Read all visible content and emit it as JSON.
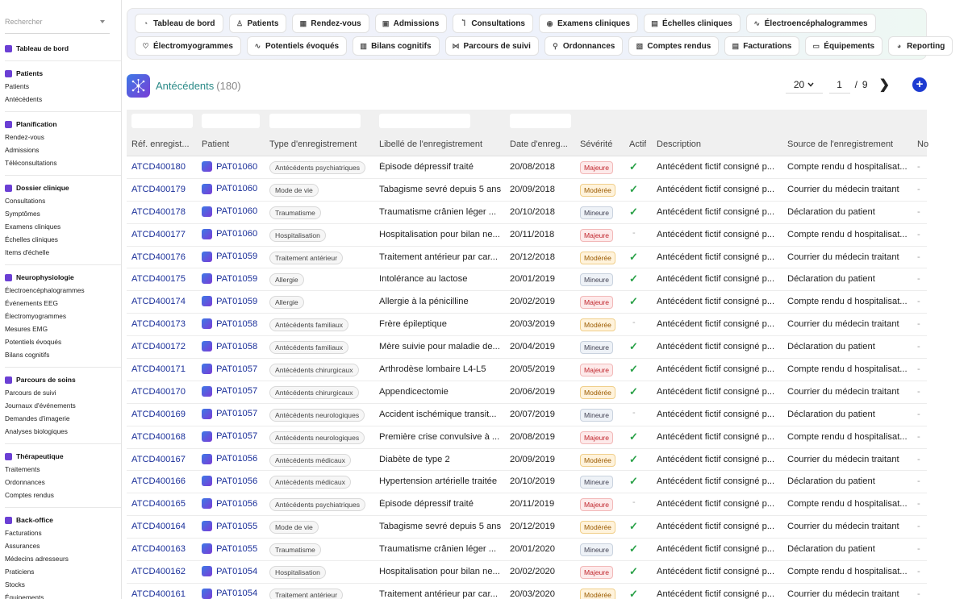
{
  "sidebar": {
    "search_placeholder": "Rechercher",
    "sections": [
      {
        "title": "Tableau de bord",
        "icon": "dashboard-icon",
        "items": []
      },
      {
        "title": "Patients",
        "icon": "user-icon",
        "items": [
          "Patients",
          "Antécédents"
        ]
      },
      {
        "title": "Planification",
        "icon": "calendar-icon",
        "items": [
          "Rendez-vous",
          "Admissions",
          "Téléconsultations"
        ]
      },
      {
        "title": "Dossier clinique",
        "icon": "stethoscope-icon",
        "items": [
          "Consultations",
          "Symptômes",
          "Examens cliniques",
          "Échelles cliniques",
          "Items d'échelle"
        ]
      },
      {
        "title": "Neurophysiologie",
        "icon": "waveform-icon",
        "items": [
          "Électroencéphalogrammes",
          "Événements EEG",
          "Électromyogrammes",
          "Mesures EMG",
          "Potentiels évoqués",
          "Bilans cognitifs"
        ]
      },
      {
        "title": "Parcours de soins",
        "icon": "flow-icon",
        "items": [
          "Parcours de suivi",
          "Journaux d'événements",
          "Demandes d'imagerie",
          "Analyses biologiques"
        ]
      },
      {
        "title": "Thérapeutique",
        "icon": "pills-icon",
        "items": [
          "Traitements",
          "Ordonnances",
          "Comptes rendus"
        ]
      },
      {
        "title": "Back-office",
        "icon": "building-icon",
        "items": [
          "Facturations",
          "Assurances",
          "Médecins adresseurs",
          "Praticiens",
          "Stocks",
          "Équipements"
        ]
      }
    ]
  },
  "nav": {
    "row1": [
      {
        "label": "Tableau de bord",
        "icon": "dashboard-icon"
      },
      {
        "label": "Patients",
        "icon": "user-icon"
      },
      {
        "label": "Rendez-vous",
        "icon": "calendar-icon"
      },
      {
        "label": "Admissions",
        "icon": "clipboard-icon"
      },
      {
        "label": "Consultations",
        "icon": "stethoscope-icon"
      },
      {
        "label": "Examens cliniques",
        "icon": "brain-icon"
      },
      {
        "label": "Échelles cliniques",
        "icon": "scale-icon"
      },
      {
        "label": "Électroencéphalogrammes",
        "icon": "waveform-icon"
      }
    ],
    "row2": [
      {
        "label": "Électromyogrammes",
        "icon": "heart-icon"
      },
      {
        "label": "Potentiels évoqués",
        "icon": "waveform-icon"
      },
      {
        "label": "Bilans cognitifs",
        "icon": "book-icon"
      },
      {
        "label": "Parcours de suivi",
        "icon": "flow-icon"
      },
      {
        "label": "Ordonnances",
        "icon": "pills-icon"
      },
      {
        "label": "Comptes rendus",
        "icon": "document-icon"
      },
      {
        "label": "Facturations",
        "icon": "invoice-icon"
      },
      {
        "label": "Équipements",
        "icon": "monitor-icon"
      },
      {
        "label": "Reporting",
        "icon": "pie-chart-icon"
      }
    ]
  },
  "page": {
    "title": "Antécédents",
    "count": "(180)",
    "per_page": "20",
    "current_page": "1",
    "separator": "/",
    "total_pages": "9",
    "next_label": "❯",
    "add_label": "+"
  },
  "table": {
    "columns": [
      "Réf. enregist...",
      "Patient",
      "Type d'enregistrement",
      "Libellé de l'enregistrement",
      "Date d'enreg...",
      "Sévérité",
      "Actif",
      "Description",
      "Source de l'enregistrement",
      "No"
    ],
    "rows": [
      {
        "ref": "ATCD400180",
        "patient": "PAT01060",
        "type": "Antécédents psychiatriques",
        "label": "Épisode dépressif traité",
        "date": "20/08/2018",
        "severity": "Majeure",
        "active": true,
        "description": "Antécédent fictif consigné p...",
        "source": "Compte rendu d hospitalisat...",
        "notes": "-"
      },
      {
        "ref": "ATCD400179",
        "patient": "PAT01060",
        "type": "Mode de vie",
        "label": "Tabagisme sevré depuis 5 ans",
        "date": "20/09/2018",
        "severity": "Modérée",
        "active": true,
        "description": "Antécédent fictif consigné p...",
        "source": "Courrier du médecin traitant",
        "notes": "-"
      },
      {
        "ref": "ATCD400178",
        "patient": "PAT01060",
        "type": "Traumatisme",
        "label": "Traumatisme crânien léger ...",
        "date": "20/10/2018",
        "severity": "Mineure",
        "active": true,
        "description": "Antécédent fictif consigné p...",
        "source": "Déclaration du patient",
        "notes": "-"
      },
      {
        "ref": "ATCD400177",
        "patient": "PAT01060",
        "type": "Hospitalisation",
        "label": "Hospitalisation pour bilan ne...",
        "date": "20/11/2018",
        "severity": "Majeure",
        "active": false,
        "description": "Antécédent fictif consigné p...",
        "source": "Compte rendu d hospitalisat...",
        "notes": "-"
      },
      {
        "ref": "ATCD400176",
        "patient": "PAT01059",
        "type": "Traitement antérieur",
        "label": "Traitement antérieur par car...",
        "date": "20/12/2018",
        "severity": "Modérée",
        "active": true,
        "description": "Antécédent fictif consigné p...",
        "source": "Courrier du médecin traitant",
        "notes": "-"
      },
      {
        "ref": "ATCD400175",
        "patient": "PAT01059",
        "type": "Allergie",
        "label": "Intolérance au lactose",
        "date": "20/01/2019",
        "severity": "Mineure",
        "active": true,
        "description": "Antécédent fictif consigné p...",
        "source": "Déclaration du patient",
        "notes": "-"
      },
      {
        "ref": "ATCD400174",
        "patient": "PAT01059",
        "type": "Allergie",
        "label": "Allergie à la pénicilline",
        "date": "20/02/2019",
        "severity": "Majeure",
        "active": true,
        "description": "Antécédent fictif consigné p...",
        "source": "Compte rendu d hospitalisat...",
        "notes": "-"
      },
      {
        "ref": "ATCD400173",
        "patient": "PAT01058",
        "type": "Antécédents familiaux",
        "label": "Frère épileptique",
        "date": "20/03/2019",
        "severity": "Modérée",
        "active": false,
        "description": "Antécédent fictif consigné p...",
        "source": "Courrier du médecin traitant",
        "notes": "-"
      },
      {
        "ref": "ATCD400172",
        "patient": "PAT01058",
        "type": "Antécédents familiaux",
        "label": "Mère suivie pour maladie de...",
        "date": "20/04/2019",
        "severity": "Mineure",
        "active": true,
        "description": "Antécédent fictif consigné p...",
        "source": "Déclaration du patient",
        "notes": "-"
      },
      {
        "ref": "ATCD400171",
        "patient": "PAT01057",
        "type": "Antécédents chirurgicaux",
        "label": "Arthrodèse lombaire L4-L5",
        "date": "20/05/2019",
        "severity": "Majeure",
        "active": true,
        "description": "Antécédent fictif consigné p...",
        "source": "Compte rendu d hospitalisat...",
        "notes": "-"
      },
      {
        "ref": "ATCD400170",
        "patient": "PAT01057",
        "type": "Antécédents chirurgicaux",
        "label": "Appendicectomie",
        "date": "20/06/2019",
        "severity": "Modérée",
        "active": true,
        "description": "Antécédent fictif consigné p...",
        "source": "Courrier du médecin traitant",
        "notes": "-"
      },
      {
        "ref": "ATCD400169",
        "patient": "PAT01057",
        "type": "Antécédents neurologiques",
        "label": "Accident ischémique transit...",
        "date": "20/07/2019",
        "severity": "Mineure",
        "active": false,
        "description": "Antécédent fictif consigné p...",
        "source": "Déclaration du patient",
        "notes": "-"
      },
      {
        "ref": "ATCD400168",
        "patient": "PAT01057",
        "type": "Antécédents neurologiques",
        "label": "Première crise convulsive à ...",
        "date": "20/08/2019",
        "severity": "Majeure",
        "active": true,
        "description": "Antécédent fictif consigné p...",
        "source": "Compte rendu d hospitalisat...",
        "notes": "-"
      },
      {
        "ref": "ATCD400167",
        "patient": "PAT01056",
        "type": "Antécédents médicaux",
        "label": "Diabète de type 2",
        "date": "20/09/2019",
        "severity": "Modérée",
        "active": true,
        "description": "Antécédent fictif consigné p...",
        "source": "Courrier du médecin traitant",
        "notes": "-"
      },
      {
        "ref": "ATCD400166",
        "patient": "PAT01056",
        "type": "Antécédents médicaux",
        "label": "Hypertension artérielle traitée",
        "date": "20/10/2019",
        "severity": "Mineure",
        "active": true,
        "description": "Antécédent fictif consigné p...",
        "source": "Déclaration du patient",
        "notes": "-"
      },
      {
        "ref": "ATCD400165",
        "patient": "PAT01056",
        "type": "Antécédents psychiatriques",
        "label": "Épisode dépressif traité",
        "date": "20/11/2019",
        "severity": "Majeure",
        "active": false,
        "description": "Antécédent fictif consigné p...",
        "source": "Compte rendu d hospitalisat...",
        "notes": "-"
      },
      {
        "ref": "ATCD400164",
        "patient": "PAT01055",
        "type": "Mode de vie",
        "label": "Tabagisme sevré depuis 5 ans",
        "date": "20/12/2019",
        "severity": "Modérée",
        "active": true,
        "description": "Antécédent fictif consigné p...",
        "source": "Courrier du médecin traitant",
        "notes": "-"
      },
      {
        "ref": "ATCD400163",
        "patient": "PAT01055",
        "type": "Traumatisme",
        "label": "Traumatisme crânien léger ...",
        "date": "20/01/2020",
        "severity": "Mineure",
        "active": true,
        "description": "Antécédent fictif consigné p...",
        "source": "Déclaration du patient",
        "notes": "-"
      },
      {
        "ref": "ATCD400162",
        "patient": "PAT01054",
        "type": "Hospitalisation",
        "label": "Hospitalisation pour bilan ne...",
        "date": "20/02/2020",
        "severity": "Majeure",
        "active": true,
        "description": "Antécédent fictif consigné p...",
        "source": "Compte rendu d hospitalisat...",
        "notes": "-"
      },
      {
        "ref": "ATCD400161",
        "patient": "PAT01054",
        "type": "Traitement antérieur",
        "label": "Traitement antérieur par car...",
        "date": "20/03/2020",
        "severity": "Modérée",
        "active": true,
        "description": "Antécédent fictif consigné p...",
        "source": "Courrier du médecin traitant",
        "notes": "-"
      }
    ],
    "inactive_symbol": "-",
    "active_symbol": "✓"
  },
  "colors": {
    "accent": "#1d3bd1",
    "title": "#2a8a87",
    "link": "#1a2f9a",
    "sidebar_icon": "#6b3fd4"
  }
}
